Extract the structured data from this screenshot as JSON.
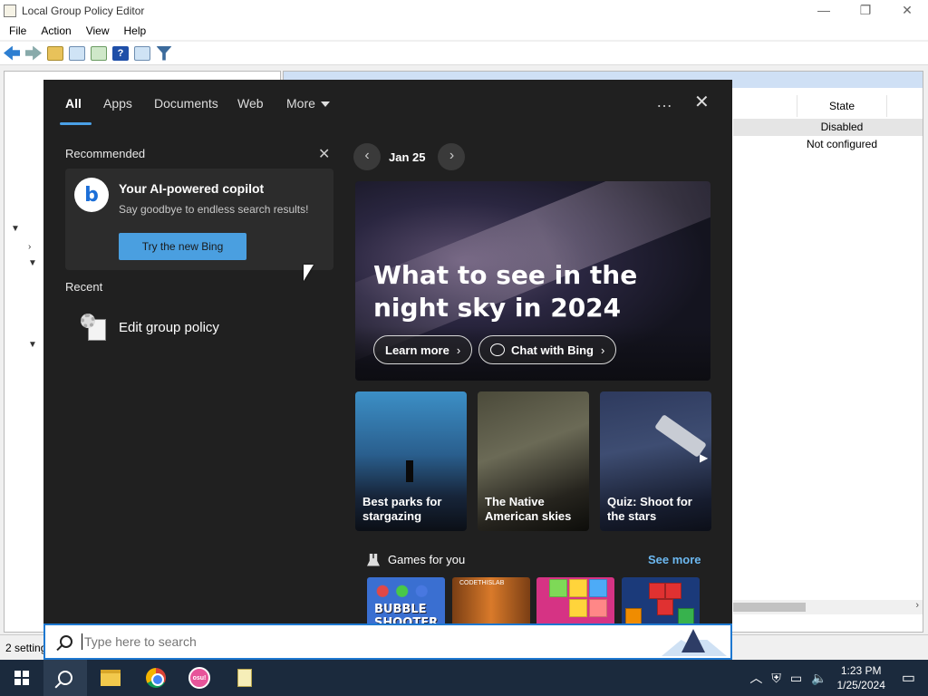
{
  "window": {
    "title": "Local Group Policy Editor",
    "controls": [
      "—",
      "❐",
      "✕"
    ]
  },
  "menu": [
    "File",
    "Action",
    "View",
    "Help"
  ],
  "right_pane": {
    "column_header": "State",
    "rows": [
      "Disabled",
      "Not configured"
    ]
  },
  "status_bar": {
    "text": "2 setting"
  },
  "search_flyout": {
    "tabs": [
      {
        "label": "All",
        "active": true
      },
      {
        "label": "Apps"
      },
      {
        "label": "Documents"
      },
      {
        "label": "Web"
      },
      {
        "label": "More"
      }
    ],
    "options_icon": "…",
    "close_icon": "✕",
    "recommended": {
      "heading": "Recommended",
      "card": {
        "title": "Your AI-powered copilot",
        "subtitle": "Say goodbye to endless search results!",
        "button": "Try the new Bing",
        "logo_letter": "b"
      }
    },
    "recent": {
      "heading": "Recent",
      "items": [
        {
          "label": "Edit group policy"
        }
      ]
    },
    "date_label": "Jan 25",
    "hero": {
      "title": "What to see in the night sky in 2024",
      "buttons": [
        "Learn more",
        "Chat with Bing"
      ]
    },
    "tiles": [
      {
        "label": "Best parks for stargazing"
      },
      {
        "label": "The Native American skies"
      },
      {
        "label": "Quiz: Shoot for the stars"
      }
    ],
    "games": {
      "heading": "Games for you",
      "see_more": "See more",
      "g1_text": "BUBBLE SHOOTER HD",
      "g2_text": "CODETHISLAB"
    },
    "search_box": {
      "placeholder": "Type here to search"
    }
  },
  "taskbar": {
    "clock_time": "1:23 PM",
    "clock_date": "1/25/2024",
    "osu_label": "osu!"
  },
  "colors": {
    "accent": "#4aa0e6",
    "flyout_bg": "#202020",
    "taskbar_bg": "#1b2a3d",
    "link": "#6cb8f0"
  }
}
